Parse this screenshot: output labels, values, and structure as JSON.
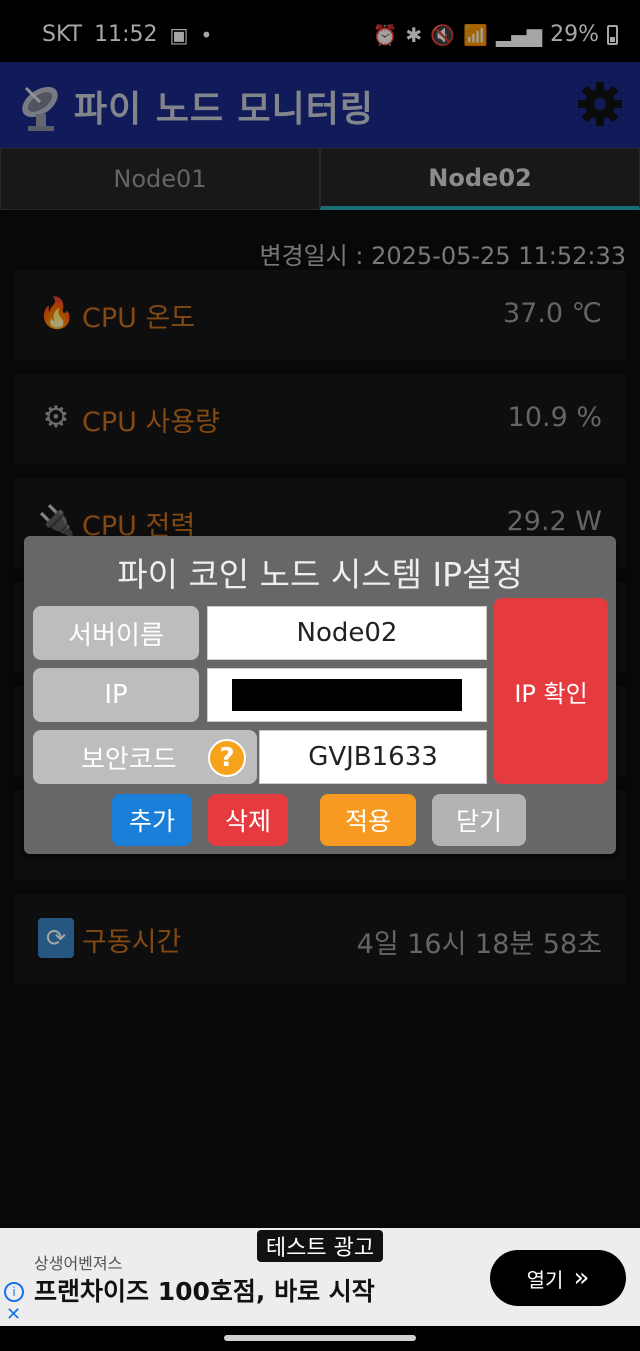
{
  "status_bar": {
    "carrier": "SKT",
    "time": "11:52",
    "battery": "29%"
  },
  "app": {
    "title": "파이 노드 모니터링"
  },
  "tabs": [
    {
      "label": "Node01",
      "active": false
    },
    {
      "label": "Node02",
      "active": true
    }
  ],
  "changed_time": "변경일시 : 2025-05-25 11:52:33",
  "metrics": [
    {
      "label": "CPU 온도",
      "value": "37.0 ℃",
      "icon": "fire-icon"
    },
    {
      "label": "CPU 사용량",
      "value": "10.9 %",
      "icon": "gear-icon"
    },
    {
      "label": "CPU 전력",
      "value": "29.2 W",
      "icon": "plug-icon"
    },
    {
      "label": "구동시간",
      "value": "4일 16시 18분 58초",
      "icon": "refresh-icon"
    }
  ],
  "dialog": {
    "title": "파이 코인 노드 시스템 IP설정",
    "server_name_label": "서버이름",
    "server_name_value": "Node02",
    "ip_label": "IP",
    "security_code_label": "보안코드",
    "security_code_value": "GVJB1633",
    "ip_check_label": "IP 확인",
    "add_label": "추가",
    "delete_label": "삭제",
    "apply_label": "적용",
    "close_label": "닫기",
    "help_symbol": "?"
  },
  "ad": {
    "badge": "테스트 광고",
    "advertiser": "상생어벤져스",
    "headline": "프랜차이즈 100호점, 바로 시작",
    "open_label": "열기",
    "open_arrow": "»"
  },
  "colors": {
    "app_bar": "#1c2a8a",
    "metric_label": "#c9701c",
    "tab_indicator": "#2aa9b8",
    "add_button": "#1a7fd8",
    "delete_button": "#e53b3f",
    "apply_button": "#f79a22",
    "close_button": "#b3b3b3",
    "ip_check_button": "#e53b3f"
  }
}
